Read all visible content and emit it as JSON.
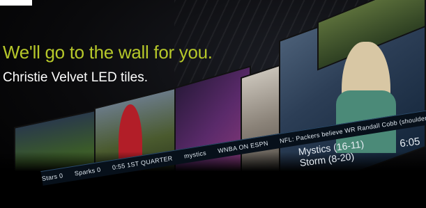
{
  "headline": "We'll go to the wall for you.",
  "subheadline": "Christie Velvet LED tiles.",
  "scoreboard": {
    "team_home": "Mystics (16-11)",
    "team_away": "Storm (8-20)",
    "clock": "6:05",
    "quarter": "0:55 1ST QUARTER"
  },
  "ticker": {
    "items": [
      "Stars 0",
      "Sparks 0",
      "0:55 1ST QUARTER",
      "mystics",
      "WNBA ON ESPN"
    ],
    "news": "NFL: Packers believe WR Randall Cobb (shoulder sprain) has"
  },
  "colors": {
    "headline": "#b6c72a",
    "subheadline": "#ffffff",
    "background": "#000000"
  }
}
